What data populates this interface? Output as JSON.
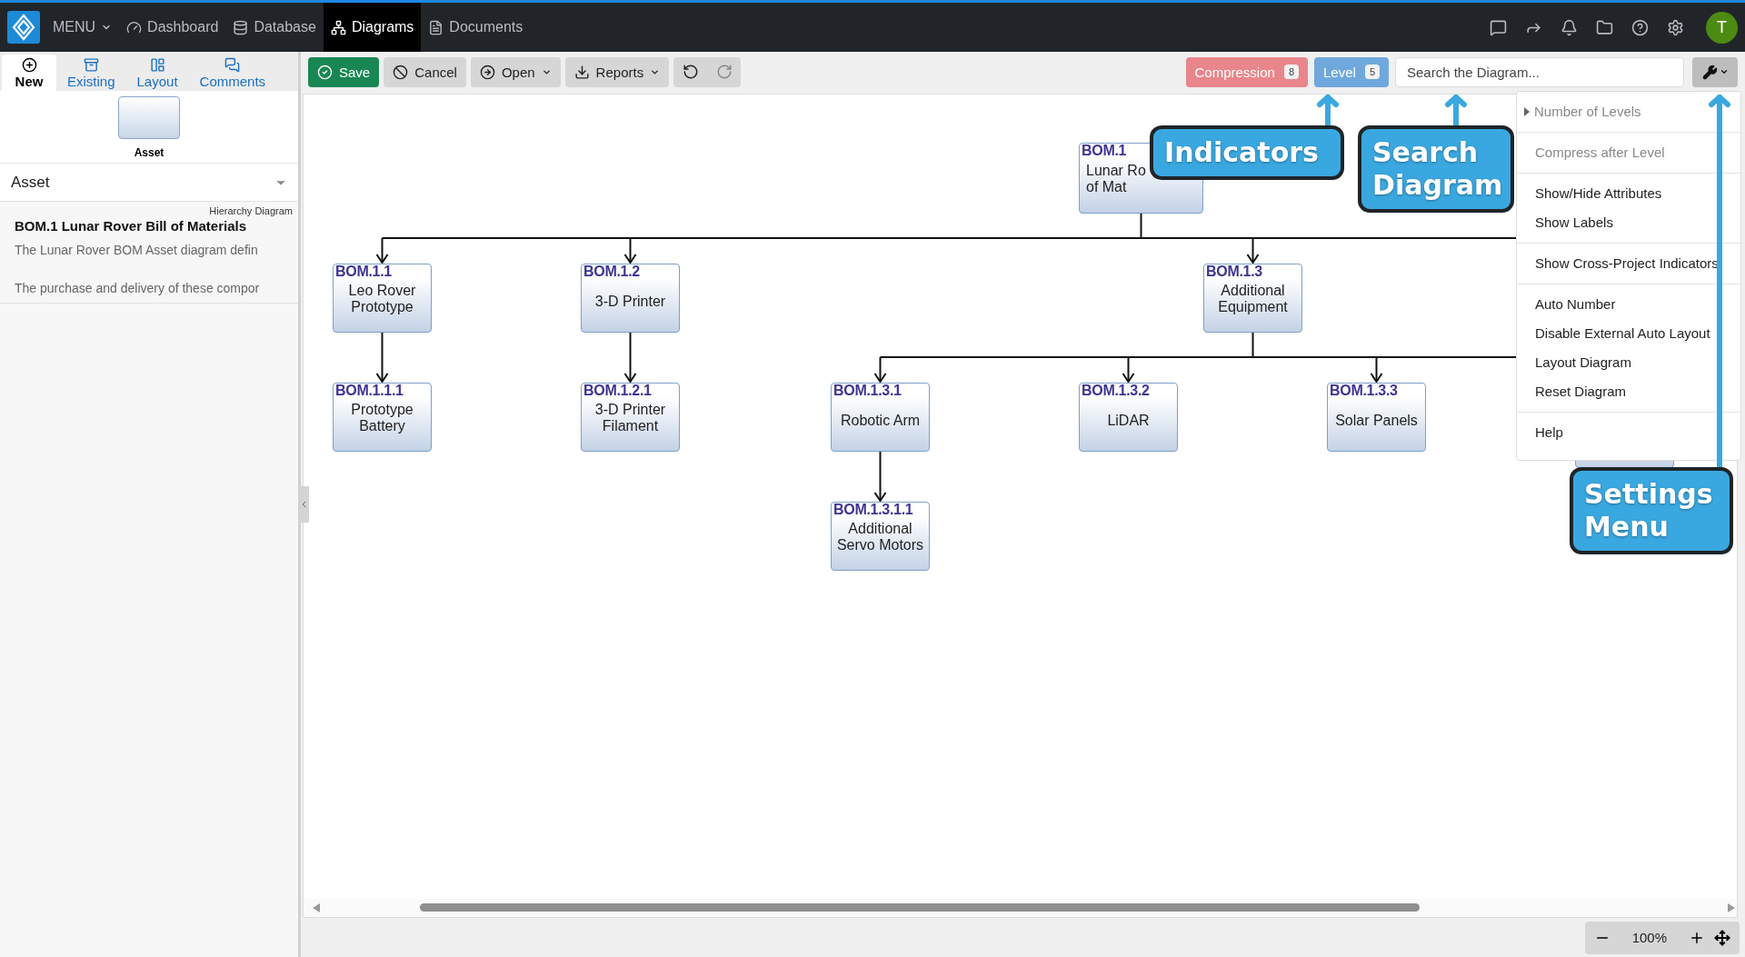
{
  "top_nav": {
    "menu_label": "MENU",
    "items": [
      {
        "label": "Dashboard",
        "selected": false
      },
      {
        "label": "Database",
        "selected": false
      },
      {
        "label": "Diagrams",
        "selected": true
      },
      {
        "label": "Documents",
        "selected": false
      }
    ],
    "avatar_initial": "T"
  },
  "sidebar": {
    "tabs": [
      {
        "label": "New",
        "selected": true
      },
      {
        "label": "Existing",
        "selected": false
      },
      {
        "label": "Layout",
        "selected": false
      },
      {
        "label": "Comments",
        "selected": false
      }
    ],
    "palette": [
      {
        "label": "Asset"
      }
    ],
    "type_select": {
      "value": "Asset"
    },
    "diagram_type": "Hierarchy Diagram",
    "diagram_title": "BOM.1 Lunar Rover Bill of Materials",
    "description": [
      "The Lunar Rover BOM Asset diagram defin",
      "The purchase and delivery of these compor"
    ]
  },
  "toolbar": {
    "buttons": [
      {
        "label": "Save",
        "kind": "primary"
      },
      {
        "label": "Cancel",
        "kind": "plain"
      },
      {
        "label": "Open",
        "kind": "dropdown"
      },
      {
        "label": "Reports",
        "kind": "dropdown"
      }
    ],
    "history": [
      {
        "kind": "undo",
        "disabled": false
      },
      {
        "kind": "redo",
        "disabled": true
      }
    ],
    "indicators": [
      {
        "label": "Compression",
        "count": "8",
        "color": "#e8868c"
      },
      {
        "label": "Level",
        "count": "5",
        "color": "#6fa8dc"
      }
    ],
    "search": {
      "placeholder": "Search the Diagram..."
    }
  },
  "diagram": {
    "root": {
      "id": "BOM.1",
      "label": [
        "Lunar Ro",
        "of Mat"
      ],
      "children": [
        {
          "id": "BOM.1.1",
          "label": [
            "Leo Rover",
            "Prototype"
          ],
          "children": [
            {
              "id": "BOM.1.1.1",
              "label": [
                "Prototype",
                "Battery"
              ]
            }
          ]
        },
        {
          "id": "BOM.1.2",
          "label": [
            "3-D Printer"
          ],
          "children": [
            {
              "id": "BOM.1.2.1",
              "label": [
                "3-D Printer",
                "Filament"
              ]
            }
          ]
        },
        {
          "id": "BOM.1.3",
          "label": [
            "Additional",
            "Equipment"
          ],
          "children": [
            {
              "id": "BOM.1.3.1",
              "label": [
                "Robotic Arm"
              ],
              "children": [
                {
                  "id": "BOM.1.3.1.1",
                  "label": [
                    "Additional",
                    "Servo Motors"
                  ]
                }
              ]
            },
            {
              "id": "BOM.1.3.2",
              "label": [
                "LiDAR"
              ]
            },
            {
              "id": "BOM.1.3.3",
              "label": [
                "Solar Panels"
              ]
            }
          ]
        }
      ]
    }
  },
  "settings_menu": {
    "groups": [
      {
        "items": [
          {
            "label": "Number of Levels",
            "kind": "submenu",
            "disabled": true
          }
        ]
      },
      {
        "items": [
          {
            "label": "Compress after Level",
            "kind": "item",
            "disabled": true
          }
        ]
      },
      {
        "items": [
          {
            "label": "Show/Hide Attributes",
            "kind": "item",
            "disabled": false
          },
          {
            "label": "Show Labels",
            "kind": "item",
            "disabled": false
          }
        ]
      },
      {
        "items": [
          {
            "label": "Show Cross-Project Indicators",
            "kind": "item",
            "disabled": false
          }
        ]
      },
      {
        "items": [
          {
            "label": "Auto Number",
            "kind": "item",
            "disabled": false
          },
          {
            "label": "Disable External Auto Layout",
            "kind": "item",
            "disabled": false
          },
          {
            "label": "Layout Diagram",
            "kind": "item",
            "disabled": false
          },
          {
            "label": "Reset Diagram",
            "kind": "item",
            "disabled": false
          }
        ]
      },
      {
        "items": [
          {
            "label": "Help",
            "kind": "item",
            "disabled": false
          }
        ]
      }
    ]
  },
  "callouts": [
    {
      "text": "Indicators"
    },
    {
      "text": "Search Diagram"
    },
    {
      "text": "Settings Menu"
    }
  ],
  "zoom": {
    "reading": "100%"
  }
}
